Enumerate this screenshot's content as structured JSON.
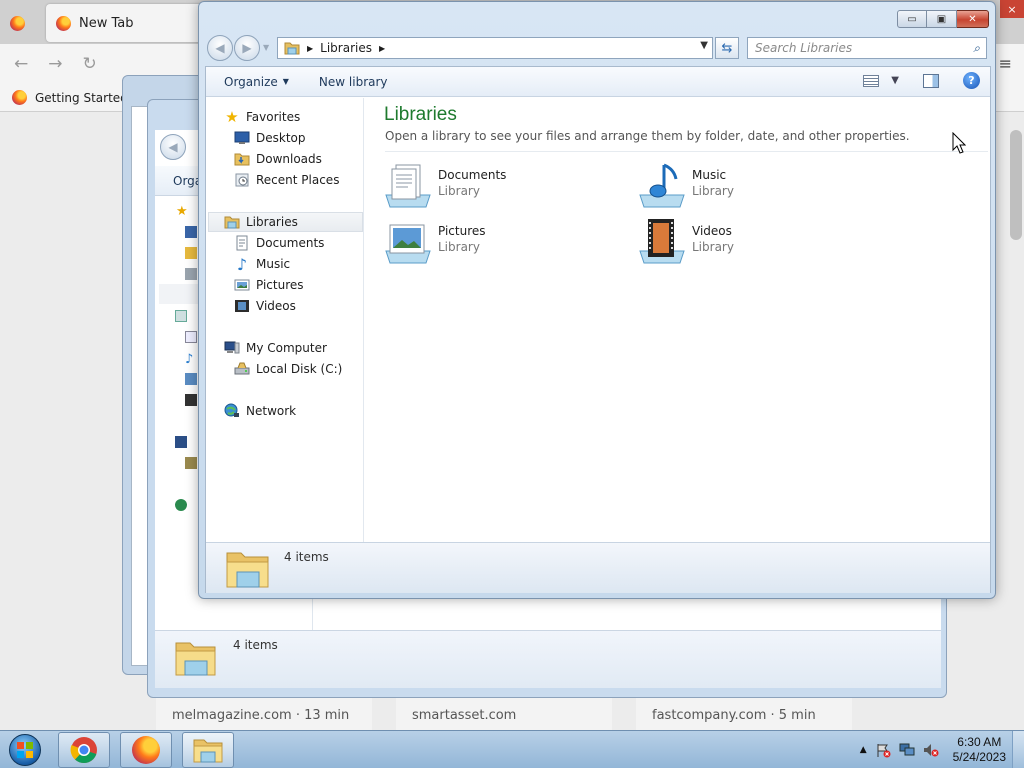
{
  "browser": {
    "tab_title": "New Tab",
    "close_glyph": "×",
    "bookmark_label": "Getting Started",
    "cards": [
      "melmagazine.com · 13 min",
      "smartasset.com",
      "fastcompany.com · 5 min"
    ]
  },
  "back_window": {
    "toolbar_label": "Orga",
    "status_text": "4 items"
  },
  "explorer": {
    "caption": {
      "minimize": "▭",
      "maximize": "▣",
      "close": "✕"
    },
    "address": {
      "location": "Libraries"
    },
    "search": {
      "placeholder": "Search Libraries"
    },
    "toolbar": {
      "organize": "Organize",
      "new_library": "New library"
    },
    "nav": {
      "favorites": "Favorites",
      "desktop": "Desktop",
      "downloads": "Downloads",
      "recent_places": "Recent Places",
      "libraries": "Libraries",
      "documents": "Documents",
      "music": "Music",
      "pictures": "Pictures",
      "videos": "Videos",
      "my_computer": "My Computer",
      "local_disk": "Local Disk (C:)",
      "network": "Network"
    },
    "content": {
      "title": "Libraries",
      "description": "Open a library to see your files and arrange them by folder, date, and other properties.",
      "libraries": [
        {
          "name": "Documents",
          "type": "Library"
        },
        {
          "name": "Music",
          "type": "Library"
        },
        {
          "name": "Pictures",
          "type": "Library"
        },
        {
          "name": "Videos",
          "type": "Library"
        }
      ]
    },
    "status": {
      "text": "4 items"
    }
  },
  "taskbar": {
    "time": "6:30 AM",
    "date": "5/24/2023",
    "tray_arrow": "▲"
  },
  "colors": {
    "title_green": "#1e7a2e",
    "window_frame": "#c6d9ec",
    "taskbar": "#a8c5e2"
  }
}
